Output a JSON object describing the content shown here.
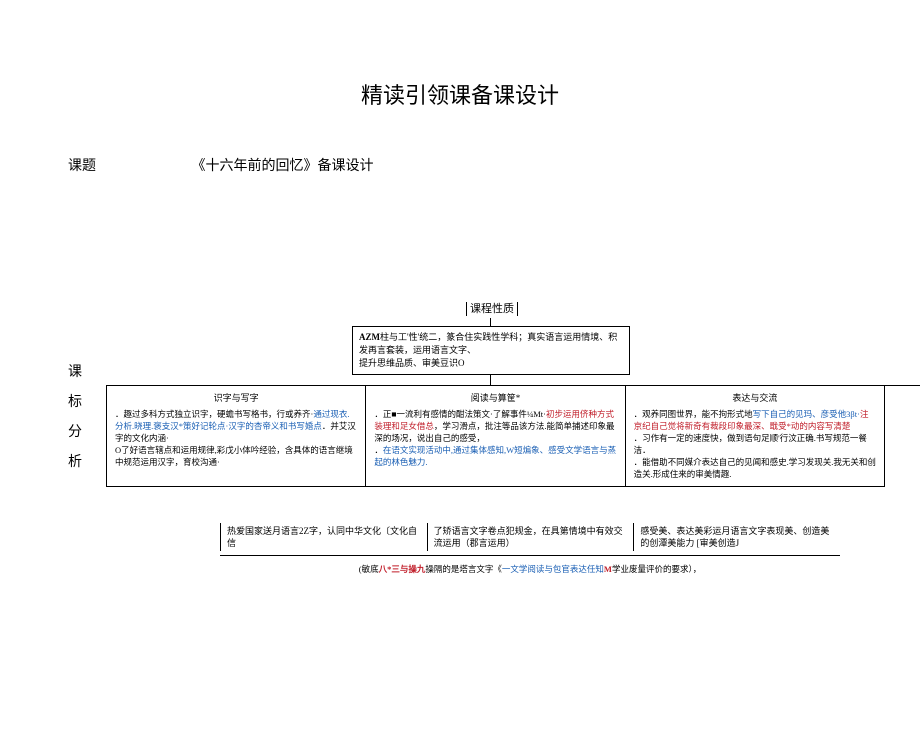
{
  "title": "精读引领课备课设计",
  "topicLabel": "课题",
  "topicTitle": "《十六年前的回忆》备课设计",
  "vertical": [
    "课",
    "标",
    "分",
    "析"
  ],
  "natureHead": "课程性质",
  "descBox": {
    "b1": "AZM",
    "t1": "柱与工'性'统二，篆合住实践性学科；真实语言运用情境、积发再言套装，运用语言文字、",
    "t2": "提升思维品质、审美豆识O"
  },
  "cols": {
    "c1": {
      "head": "识字与写字",
      "p1a": "．趣过多科方式独立识字，硬蟾书写格书，行或养齐·",
      "p1b": "通过现衣.分析.晓理.褒支汉*策好记轮点·汉字的杏帝义和书写婚点",
      "p1c": "．并艾汉字的文化内涵·",
      "p2a": "O",
      "p2b": "了好语言辖点和运用规律,彩戊小体吟经验，含具体的语言继境中规范运用汉字，育校沟通·"
    },
    "c2": {
      "head": "阅读与算筐*",
      "p1a": "．正",
      "p1b": "■",
      "p1c": "一流利有感情的酣法策文·了解事件¼Mt·",
      "p1d": "初步运用侪种方式装理和足女借总",
      "p1e": "，学习滑点，批注等品该方法.能简单捕述印象最深的场况，说出自己的感受，",
      "p2a": "．",
      "p2b": "在语文实现活动中,通过集体感知,W短煸象、感受文学语言与蒸起的林色魅力."
    },
    "c3": {
      "head": "表达与交流",
      "p1a": "．观养同图世界，能不拘形式地",
      "p1b": "写下自己的见玛、彦受他3βt·",
      "p1c": "注京纪自己觉将新奇有裁段印象最深、戢受*动的内容写清楚",
      "p2": "．习作有一定的速度快，做到语句足顺'行汶正确.书写规范一餐洁．",
      "p3": "．能借助不同媒介表达自己的见闻和感史.学习发现关.我无关和创造关.形成住来的审美情趣."
    }
  },
  "bottom": {
    "b1": "热爱国家送月语言2Z字，认同中华文化〔文化自信",
    "b2": "了矫语言文字卷点犯规金，在具第情境中有效交流运用（郡言运用）",
    "b3": "感受美、表达美彩运月语言文字表现美、创造美的创潭美能力 [审美创造J"
  },
  "caption": {
    "t1": "(敏底",
    "r1": "八*三",
    "t2": "与操九",
    "t3": "操隔的是塔言文字《",
    "b1": "一文学阅读与包官表达任知",
    "r2": "M",
    "t4": "学业废量评价的要求），"
  }
}
